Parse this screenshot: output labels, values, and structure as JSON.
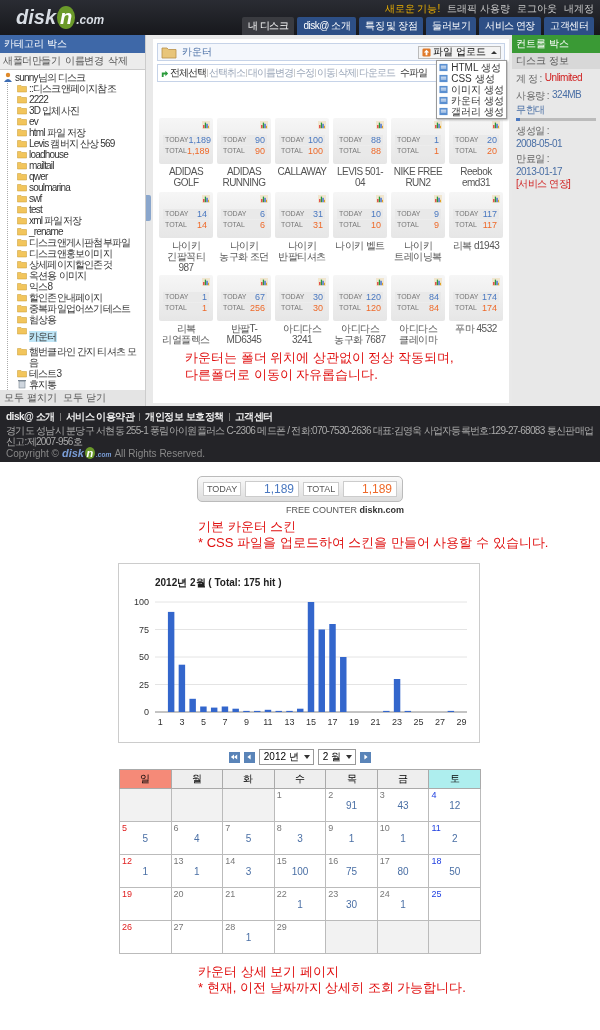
{
  "header": {
    "logo": {
      "text": "disk",
      "mark": "n",
      "suffix": ".com"
    },
    "links": [
      {
        "label": "새로운 기능!",
        "kind": "highlight"
      },
      {
        "label": "트래픽 사용량",
        "kind": "plain"
      },
      {
        "label": "로그아웃",
        "kind": "plain"
      },
      {
        "label": "내계정",
        "kind": "plain"
      }
    ],
    "tabs": [
      {
        "label": "내 디스크",
        "selected": true
      },
      {
        "label": "disk@ 소개",
        "selected": false
      },
      {
        "label": "특징 및 장점",
        "selected": false
      },
      {
        "label": "둘러보기",
        "selected": false
      },
      {
        "label": "서비스 연장",
        "selected": false
      },
      {
        "label": "고객센터",
        "selected": false
      }
    ]
  },
  "sidebar": {
    "title": "카테고리 박스",
    "tools": [
      "새폴더만들기",
      "이름변경",
      "삭제"
    ],
    "tree": {
      "label": "sunny님의 디스크",
      "kind": "root",
      "selected": false,
      "children": [
        {
          "label": "::디스크앤페이지참조",
          "kind": "folder",
          "selected": false
        },
        {
          "label": "2222",
          "kind": "folder",
          "selected": false
        },
        {
          "label": "3D 입체사진",
          "kind": "folder",
          "selected": false
        },
        {
          "label": "ev",
          "kind": "folder",
          "selected": false
        },
        {
          "label": "html 파일 저장",
          "kind": "folder",
          "selected": false
        },
        {
          "label": "Levis 캠버지 산상 569",
          "kind": "folder",
          "selected": false
        },
        {
          "label": "loadhouse",
          "kind": "folder",
          "selected": false
        },
        {
          "label": "mailtail",
          "kind": "folder",
          "selected": false
        },
        {
          "label": "qwer",
          "kind": "folder",
          "selected": false
        },
        {
          "label": "soulmarina",
          "kind": "folder",
          "selected": false
        },
        {
          "label": "swf",
          "kind": "folder",
          "selected": false
        },
        {
          "label": "test",
          "kind": "folder",
          "selected": false
        },
        {
          "label": "xml 파일저장",
          "kind": "folder",
          "selected": false
        },
        {
          "label": "_rename",
          "kind": "folder",
          "selected": false
        },
        {
          "label": "디스크앤게시판첨부파일",
          "kind": "folder",
          "selected": false
        },
        {
          "label": "디스크앤홍보이미지",
          "kind": "folder",
          "selected": false
        },
        {
          "label": "상세페이지할인존것",
          "kind": "folder",
          "selected": false
        },
        {
          "label": "옥션용 이미지",
          "kind": "folder",
          "selected": false
        },
        {
          "label": "익스8",
          "kind": "folder",
          "selected": false
        },
        {
          "label": "할인존안내페이지",
          "kind": "folder",
          "selected": false
        },
        {
          "label": "중복파일업어쓰기테스트",
          "kind": "folder",
          "selected": false
        },
        {
          "label": "험상용",
          "kind": "folder",
          "selected": false
        },
        {
          "label": "카운터",
          "kind": "folder",
          "selected": true
        },
        {
          "label": "햄번클라인 간지 티셔츠 모음",
          "kind": "folder",
          "selected": false
        },
        {
          "label": "테스트3",
          "kind": "folder",
          "selected": false
        },
        {
          "label": "휴지통",
          "kind": "trash",
          "selected": false
        }
      ]
    },
    "footer": [
      "모두 펼치기",
      "모두 닫기"
    ]
  },
  "main": {
    "title": "카운터",
    "toolbar": [
      "전체선택",
      "선택취소",
      "대이름변경",
      "수정",
      "이동",
      "삭제",
      "다운로드"
    ],
    "toolbar_right": "수파일",
    "upload_button": "파일 업로드",
    "menu": [
      {
        "label": "HTML 생성"
      },
      {
        "label": "CSS 생성"
      },
      {
        "label": "이미지 생성"
      },
      {
        "label": "카운터 생성"
      },
      {
        "label": "갤러리 생성"
      }
    ],
    "cards": [
      {
        "name": "ADIDAS GOLF",
        "today_label": "TODAY",
        "today": "1,189",
        "total_label": "TOTAL",
        "total": "1,189"
      },
      {
        "name": "ADIDAS RUNNING",
        "today_label": "TODAY",
        "today": "90",
        "total_label": "TOTAL",
        "total": "90"
      },
      {
        "name": "CALLAWAY",
        "today_label": "TODAY",
        "today": "100",
        "total_label": "TOTAL",
        "total": "100"
      },
      {
        "name": "LEVIS 501-04",
        "today_label": "TODAY",
        "today": "88",
        "total_label": "TOTAL",
        "total": "88"
      },
      {
        "name": "NIKE FREE RUN2",
        "today_label": "TODAY",
        "today": "1",
        "total_label": "TOTAL",
        "total": "1"
      },
      {
        "name": "Reebok emd31",
        "today_label": "TODAY",
        "today": "20",
        "total_label": "TOTAL",
        "total": "20"
      },
      {
        "name": "나이키 긴팔꼭티 987",
        "today_label": "TODAY",
        "today": "14",
        "total_label": "TOTAL",
        "total": "14"
      },
      {
        "name": "나이키 농구화 조던",
        "today_label": "TODAY",
        "today": "6",
        "total_label": "TOTAL",
        "total": "6"
      },
      {
        "name": "나이키 반팔티셔츠",
        "today_label": "TODAY",
        "today": "31",
        "total_label": "TOTAL",
        "total": "31"
      },
      {
        "name": "나이키 벨트",
        "today_label": "TODAY",
        "today": "10",
        "total_label": "TOTAL",
        "total": "10"
      },
      {
        "name": "나이키 트레이닝복",
        "today_label": "TODAY",
        "today": "9",
        "total_label": "TOTAL",
        "total": "9"
      },
      {
        "name": "리복 d1943",
        "today_label": "TODAY",
        "today": "117",
        "total_label": "TOTAL",
        "total": "117"
      },
      {
        "name": "리복 리얼플렉스",
        "today_label": "TODAY",
        "today": "1",
        "total_label": "TOTAL",
        "total": "1"
      },
      {
        "name": "반팔T-MD6345",
        "today_label": "TODAY",
        "today": "67",
        "total_label": "TOTAL",
        "total": "256"
      },
      {
        "name": "아디다스 3241",
        "today_label": "TODAY",
        "today": "30",
        "total_label": "TOTAL",
        "total": "30"
      },
      {
        "name": "아디다스 농구화 7687",
        "today_label": "TODAY",
        "today": "120",
        "total_label": "TOTAL",
        "total": "120"
      },
      {
        "name": "아디다스 클레이마",
        "today_label": "TODAY",
        "today": "84",
        "total_label": "TOTAL",
        "total": "84"
      },
      {
        "name": "푸마 4532",
        "today_label": "TODAY",
        "today": "174",
        "total_label": "TOTAL",
        "total": "174"
      }
    ],
    "caption": [
      "카운터는 폴더 위치에 상관없이 정상 작동되며,",
      "다른폴더로 이동이 자유롭습니다."
    ]
  },
  "control_box": {
    "title": "컨트롤 박스",
    "section": "디스크 정보",
    "rows": [
      {
        "label": "계 정 :",
        "value": "Unlimited",
        "kind": "alert"
      },
      {
        "label": "사용량 :",
        "value": "324MB",
        "extra": "무한대",
        "kind": "usage",
        "level": 0.05
      },
      {
        "label": "생성일 :",
        "value": "2008-05-01",
        "kind": "plain"
      },
      {
        "label": "만료일 :",
        "value": "2013-01-17",
        "extra": "[서비스 연장]",
        "kind": "link"
      }
    ]
  },
  "footer": {
    "links": [
      "disk@ 소개",
      "서비스 이용약관",
      "개인정보 보호정책",
      "고객센터"
    ],
    "address": "경기도 성남시 분당구 서현동 255-1 풍림아이원플러스 C-2306 메드폰 / 전화:070-7530-2636 대표:김영욱 사업자등록번호:129-27-68083 통신판매업신고:제2007-956호",
    "copyright": "Copyright ©",
    "logo": {
      "text": "disk",
      "mark": "n",
      "suffix": ".com"
    },
    "rights": "All Rights Reserved."
  },
  "counter_skin": {
    "today_label": "TODAY",
    "today": "1,189",
    "total_label": "TOTAL",
    "total": "1,189",
    "credit": "FREE COUNTER",
    "credit_brand": "diskn.com"
  },
  "caption_1": [
    "기본 카운터 스킨",
    "* CSS 파일을 업로드하여 스킨을 만들어 사용할 수 있습니다."
  ],
  "chart": {
    "chart_data": {
      "type": "bar",
      "title": "2012년 2월 ( Total: 175 hit )",
      "x": [
        1,
        2,
        3,
        4,
        5,
        6,
        7,
        8,
        9,
        10,
        11,
        12,
        13,
        14,
        15,
        16,
        17,
        18,
        19,
        20,
        21,
        22,
        23,
        24,
        25,
        26,
        27,
        28,
        29
      ],
      "series": [
        {
          "color": "#3366cc",
          "values": [
            0,
            91,
            43,
            12,
            5,
            4,
            5,
            3,
            1,
            1,
            2,
            1,
            1,
            3,
            100,
            75,
            80,
            50,
            0,
            0,
            0,
            1,
            30,
            1,
            0,
            0,
            0,
            1,
            0
          ]
        }
      ],
      "xlim": [
        0.5,
        29.5
      ],
      "ylim": [
        0,
        100
      ],
      "grid": true,
      "yticks": [
        0,
        25,
        50,
        75,
        100
      ],
      "xticks": [
        1,
        3,
        5,
        7,
        9,
        11,
        13,
        15,
        17,
        19,
        21,
        23,
        25,
        27,
        29
      ]
    }
  },
  "calendar": {
    "year": "2012 년",
    "month": "2 월",
    "weekdays": [
      {
        "label": "일",
        "kind": "sun"
      },
      {
        "label": "월",
        "kind": "week"
      },
      {
        "label": "화",
        "kind": "week"
      },
      {
        "label": "수",
        "kind": "week"
      },
      {
        "label": "목",
        "kind": "week"
      },
      {
        "label": "금",
        "kind": "week"
      },
      {
        "label": "토",
        "kind": "sat"
      }
    ],
    "weeks": [
      [
        {
          "kind": "blank"
        },
        {
          "kind": "blank"
        },
        {
          "kind": "blank"
        },
        {
          "day": "1"
        },
        {
          "day": "2",
          "value": "91"
        },
        {
          "day": "3",
          "value": "43"
        },
        {
          "day": "4",
          "value": "12"
        }
      ],
      [
        {
          "day": "5",
          "value": "5"
        },
        {
          "day": "6",
          "value": "4"
        },
        {
          "day": "7",
          "value": "5"
        },
        {
          "day": "8",
          "value": "3"
        },
        {
          "day": "9",
          "value": "1"
        },
        {
          "day": "10",
          "value": "1"
        },
        {
          "day": "11",
          "value": "2"
        }
      ],
      [
        {
          "day": "12",
          "value": "1"
        },
        {
          "day": "13",
          "value": "1"
        },
        {
          "day": "14",
          "value": "3"
        },
        {
          "day": "15",
          "value": "100"
        },
        {
          "day": "16",
          "value": "75"
        },
        {
          "day": "17",
          "value": "80"
        },
        {
          "day": "18",
          "value": "50"
        }
      ],
      [
        {
          "day": "19"
        },
        {
          "day": "20"
        },
        {
          "day": "21"
        },
        {
          "day": "22",
          "value": "1"
        },
        {
          "day": "23",
          "value": "30"
        },
        {
          "day": "24",
          "value": "1"
        },
        {
          "day": "25"
        }
      ],
      [
        {
          "day": "26"
        },
        {
          "day": "27"
        },
        {
          "day": "28",
          "value": "1"
        },
        {
          "day": "29"
        },
        {
          "kind": "blank"
        },
        {
          "kind": "blank"
        },
        {
          "kind": "blank"
        }
      ]
    ]
  },
  "caption_2": [
    "카운터 상세 보기 페이지",
    "* 현재, 이전 날짜까지 상세히 조회 가능합니다."
  ]
}
